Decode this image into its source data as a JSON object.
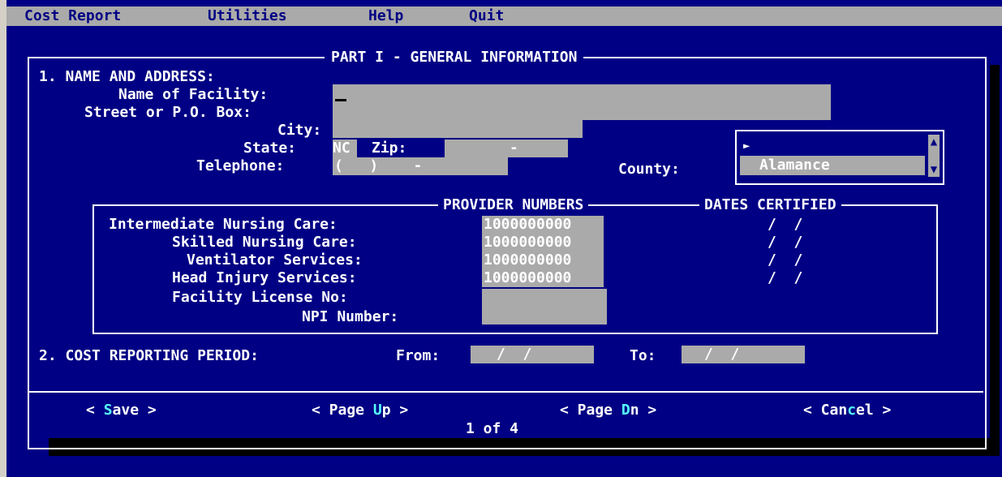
{
  "menu": {
    "cost_report": "Cost Report",
    "utilities": "Utilities",
    "help": "Help",
    "quit": "Quit"
  },
  "form": {
    "title": "PART I - GENERAL INFORMATION",
    "section1": "1. NAME AND ADDRESS:",
    "facility_label": "Name of Facility:",
    "street_label": "Street or P.O. Box:",
    "city_label": "City:",
    "state_label": "State:",
    "state_value": "NC",
    "zip_label": "Zip:",
    "zip_sep": "-",
    "phone_label": "Telephone:",
    "phone_mask": "(   )    -",
    "county_label": "County:",
    "county_selected": "Alamance",
    "provider_title": "PROVIDER NUMBERS",
    "dates_title": "DATES CERTIFIED",
    "rows": [
      {
        "label": "Intermediate Nursing Care:",
        "number": "1000000000",
        "date": "/  /"
      },
      {
        "label": "Skilled Nursing Care:",
        "number": "1000000000",
        "date": "/  /"
      },
      {
        "label": "Ventilator Services:",
        "number": "1000000000",
        "date": "/  /"
      },
      {
        "label": "Head Injury Services:",
        "number": "1000000000",
        "date": "/  /"
      }
    ],
    "license_label": "Facility License No:",
    "npi_label": "NPI Number:",
    "section2": "2. COST REPORTING PERIOD:",
    "from_label": "From:",
    "from_value": "/  /",
    "to_label": "To:",
    "to_value": "/  /"
  },
  "buttons": {
    "save_pre": "< ",
    "save_hk": "S",
    "save_post": "ave >",
    "pageup_pre": "< Page ",
    "pageup_hk": "U",
    "pageup_post": "p >",
    "pagedn_pre": "< Page ",
    "pagedn_hk": "D",
    "pagedn_post": "n >",
    "cancel_pre": "< Can",
    "cancel_hk": "c",
    "cancel_post": "el >"
  },
  "page_indicator": "1 of 4",
  "colors": {
    "background": "#000084",
    "field": "#aaaaaa",
    "hotkey": "#55ffff"
  }
}
